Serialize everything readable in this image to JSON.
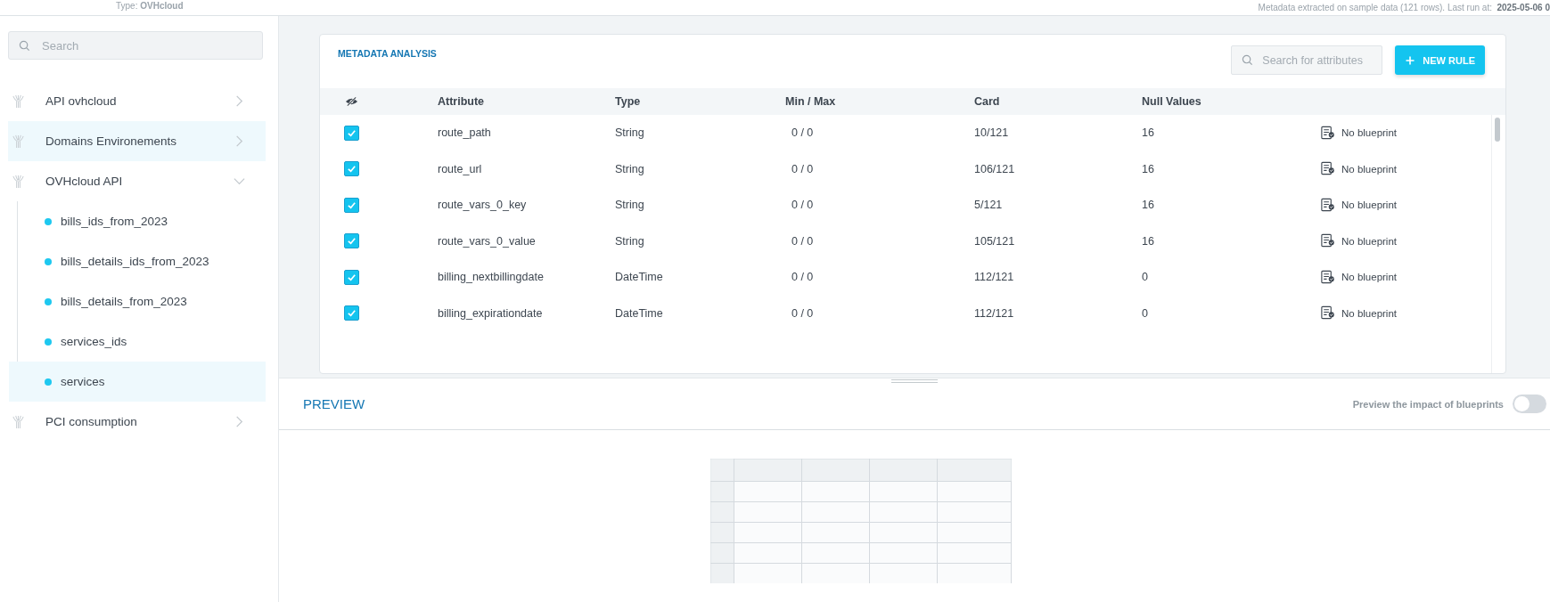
{
  "header": {
    "type_label": "Type:",
    "type_value": "OVHcloud",
    "run_info": "Metadata extracted on sample data (121 rows).  Last run at:",
    "run_date": "2025-05-06 0"
  },
  "sidebar": {
    "search": {
      "placeholder": "Search"
    },
    "items": [
      {
        "label": "API ovhcloud",
        "expanded": false,
        "selected": false
      },
      {
        "label": "Domains Environements",
        "expanded": false,
        "selected": true
      },
      {
        "label": "OVHcloud API",
        "expanded": true,
        "selected": false,
        "children": [
          {
            "label": "bills_ids_from_2023",
            "selected": false,
            "color": "#1ec8f0"
          },
          {
            "label": "bills_details_ids_from_2023",
            "selected": false,
            "color": "#1ec8f0"
          },
          {
            "label": "bills_details_from_2023",
            "selected": false,
            "color": "#1ec8f0"
          },
          {
            "label": "services_ids",
            "selected": false,
            "color": "#1ec8f0"
          },
          {
            "label": "services",
            "selected": true,
            "color": "#1ec8f0"
          }
        ]
      },
      {
        "label": "PCI consumption",
        "expanded": false,
        "selected": false
      }
    ]
  },
  "metadata": {
    "title": "METADATA ANALYSIS",
    "search": {
      "placeholder": "Search for attributes"
    },
    "new_rule": "NEW RULE",
    "columns": [
      "Attribute",
      "Type",
      "Min / Max",
      "Card",
      "Null Values"
    ],
    "rows": [
      {
        "checked": true,
        "attribute": "route_path",
        "type": "String",
        "min_max": "0 / 0",
        "card": "10/121",
        "null_values": "16",
        "blueprint": "No blueprint"
      },
      {
        "checked": true,
        "attribute": "route_url",
        "type": "String",
        "min_max": "0 / 0",
        "card": "106/121",
        "null_values": "16",
        "blueprint": "No blueprint"
      },
      {
        "checked": true,
        "attribute": "route_vars_0_key",
        "type": "String",
        "min_max": "0 / 0",
        "card": "5/121",
        "null_values": "16",
        "blueprint": "No blueprint"
      },
      {
        "checked": true,
        "attribute": "route_vars_0_value",
        "type": "String",
        "min_max": "0 / 0",
        "card": "105/121",
        "null_values": "16",
        "blueprint": "No blueprint"
      },
      {
        "checked": true,
        "attribute": "billing_nextbillingdate",
        "type": "DateTime",
        "min_max": "0 / 0",
        "card": "112/121",
        "null_values": "0",
        "blueprint": "No blueprint"
      },
      {
        "checked": true,
        "attribute": "billing_expirationdate",
        "type": "DateTime",
        "min_max": "0 / 0",
        "card": "112/121",
        "null_values": "0",
        "blueprint": "No blueprint"
      }
    ]
  },
  "preview": {
    "title": "PREVIEW",
    "toggle_label": "Preview the impact of blueprints",
    "toggle_on": false
  }
}
